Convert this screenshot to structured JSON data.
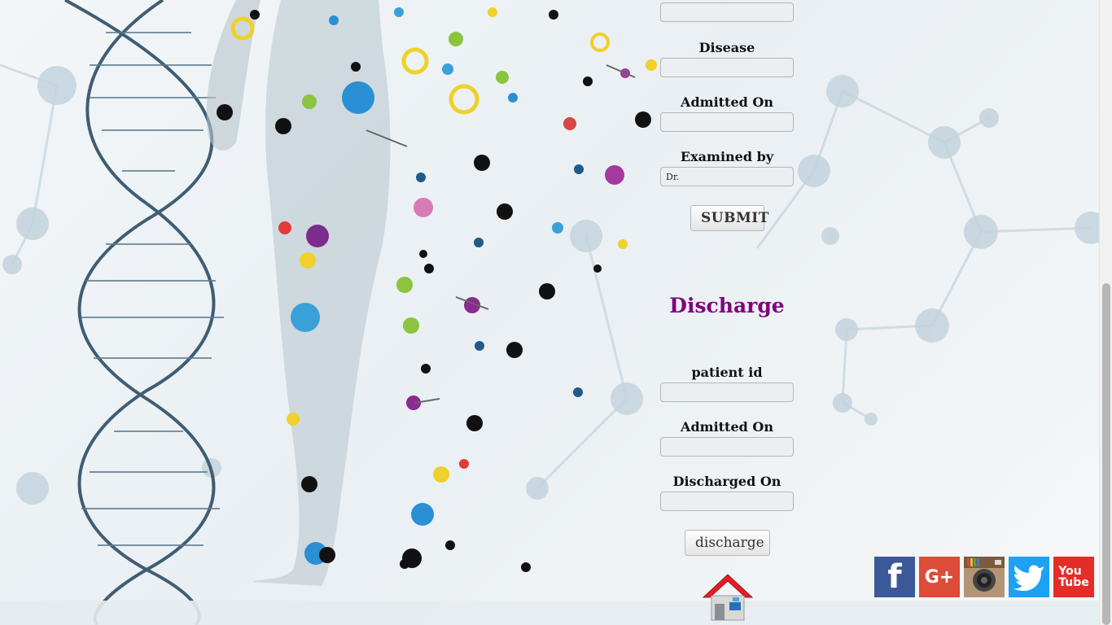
{
  "form_top": {
    "disease_label": "Disease",
    "admitted_on_label": "Admitted On",
    "examined_by_label": "Examined by",
    "examined_by_value": "Dr.",
    "submit_label": "SUBMIT"
  },
  "discharge": {
    "title": "Discharge",
    "patient_id_label": "patient id",
    "admitted_on_label": "Admitted On",
    "discharged_on_label": "Discharged On",
    "discharge_button_label": "discharge"
  },
  "social": [
    {
      "name": "facebook",
      "glyph": "f",
      "color": "#3b5998"
    },
    {
      "name": "google-plus",
      "glyph": "G+",
      "color": "#dd4b39"
    },
    {
      "name": "instagram",
      "glyph": "◉",
      "color": "#b08a66"
    },
    {
      "name": "twitter",
      "glyph": "🐦",
      "color": "#1da1f2"
    },
    {
      "name": "youtube",
      "glyph": "You\nTube",
      "color": "#e52d27"
    }
  ],
  "colors": {
    "accent": "#800080"
  }
}
